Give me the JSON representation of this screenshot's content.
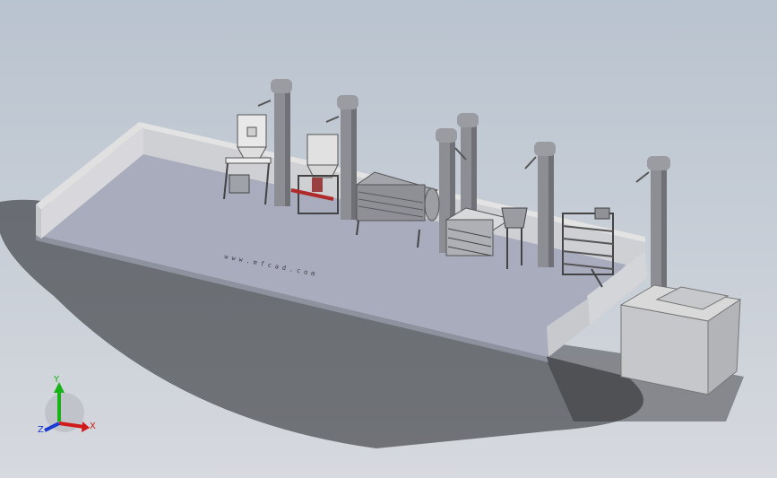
{
  "view": {
    "background_top": "#b9c3cf",
    "background_bottom": "#d6d9de",
    "floor_color": "#a8acbd",
    "wall_color": "#d9d9d9",
    "machine_color": "#8d8f94",
    "accent_red": "#b02a2a",
    "floor_text": "www.mfcad.com"
  },
  "triad": {
    "x_label": "X",
    "y_label": "Y",
    "z_label": "Z",
    "x_color": "#d11a1a",
    "y_color": "#19b219",
    "z_color": "#1a3bd1"
  },
  "equipment": [
    {
      "name": "elevator-1"
    },
    {
      "name": "elevator-2"
    },
    {
      "name": "elevator-3"
    },
    {
      "name": "elevator-4"
    },
    {
      "name": "elevator-5"
    },
    {
      "name": "elevator-6"
    },
    {
      "name": "hopper-1"
    },
    {
      "name": "hopper-2"
    },
    {
      "name": "drum-washer"
    },
    {
      "name": "screen-table"
    },
    {
      "name": "small-hopper"
    },
    {
      "name": "dryer-rack"
    },
    {
      "name": "storage-tank"
    }
  ]
}
